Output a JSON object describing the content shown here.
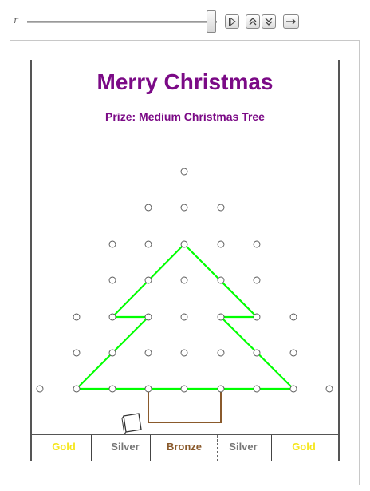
{
  "controls": {
    "variable_label": "r",
    "slider_value": 1.0,
    "buttons": [
      "play-icon",
      "step-icon",
      "step-icon",
      "direction-icon"
    ]
  },
  "header": {
    "title": "Merry Christmas",
    "prize": "Prize: Medium Christmas Tree"
  },
  "bins": [
    {
      "label": "Gold",
      "color": "#f5e61c"
    },
    {
      "label": "Silver",
      "color": "#777777"
    },
    {
      "label": "Bronze",
      "color": "#8a5a2c"
    },
    {
      "label": "Silver",
      "color": "#777777"
    },
    {
      "label": "Gold",
      "color": "#f5e61c"
    }
  ],
  "colors": {
    "title": "#7b0a86",
    "tree": "#00ff00",
    "trunk": "#8a5a2c"
  }
}
